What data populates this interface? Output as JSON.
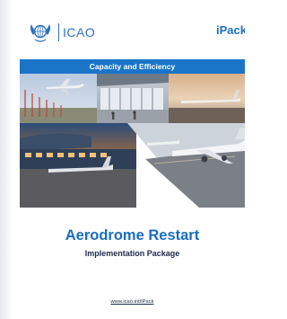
{
  "header": {
    "logo_text": "ICAO",
    "series_tag": "iPack"
  },
  "band": {
    "label": "Capacity and Efficiency"
  },
  "title": {
    "main": "Aerodrome Restart",
    "subtitle": "Implementation Package"
  },
  "footer": {
    "url": "www.icao.int/iPack"
  },
  "colors": {
    "brand_blue": "#1a75c9",
    "title_blue": "#1a6dbd",
    "navy_text": "#1d2a4a"
  }
}
